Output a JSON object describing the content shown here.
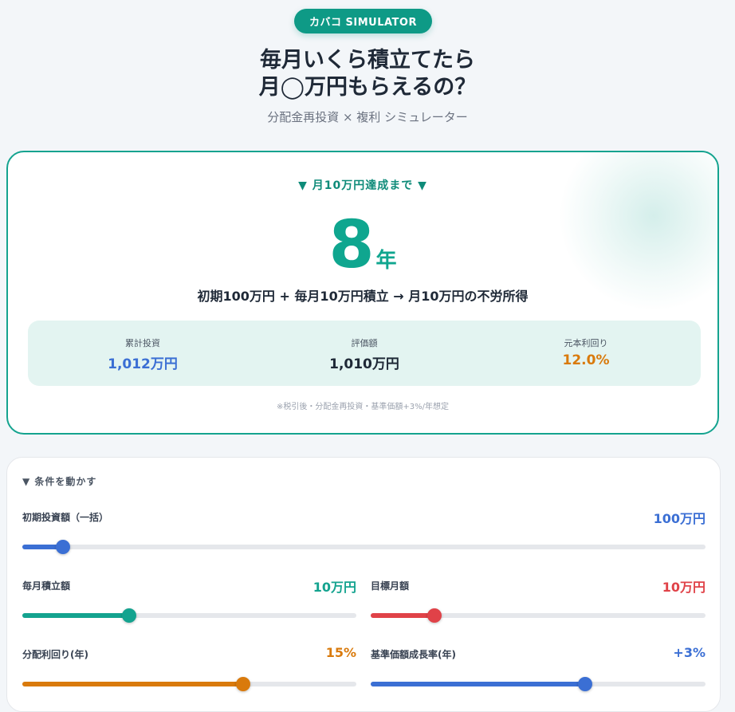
{
  "header": {
    "badge": "カバコ SIMULATOR",
    "title_line1": "毎月いくら積立てたら",
    "title_line2": "月◯万円もらえるの？",
    "subtitle": "分配金再投資 × 複利 シミュレーター"
  },
  "result": {
    "until_label": "▼ 月10万円達成まで ▼",
    "years": "8",
    "years_unit": "年",
    "summary": "初期100万円 + 毎月10万円積立 → 月10万円の不労所得",
    "stats": [
      {
        "label": "累計投資",
        "value": "1,012万円",
        "color": "#3b6fd4"
      },
      {
        "label": "評価額",
        "value": "1,010万円",
        "color": "#1f2937"
      },
      {
        "label": "元本利回り",
        "value": "12.0%",
        "color": "#d97a0c"
      }
    ],
    "note": "※税引後・分配金再投資・基準価額+3%/年想定"
  },
  "conditions": {
    "title": "▼ 条件を動かす",
    "sliders": {
      "initial": {
        "label": "初期投資額（一括）",
        "value": "100万円",
        "fraction": 0.06,
        "color": "#3b6fd4"
      },
      "monthly": {
        "label": "毎月積立額",
        "value": "10万円",
        "fraction": 0.32,
        "color": "#14a38f"
      },
      "target": {
        "label": "目標月額",
        "value": "10万円",
        "fraction": 0.19,
        "color": "#e04248"
      },
      "yield": {
        "label": "分配利回り(年)",
        "value": "15%",
        "fraction": 0.66,
        "color": "#d97a0c"
      },
      "growth": {
        "label": "基準価額成長率(年)",
        "value": "+3%",
        "fraction": 0.64,
        "color": "#3b6fd4"
      }
    }
  }
}
